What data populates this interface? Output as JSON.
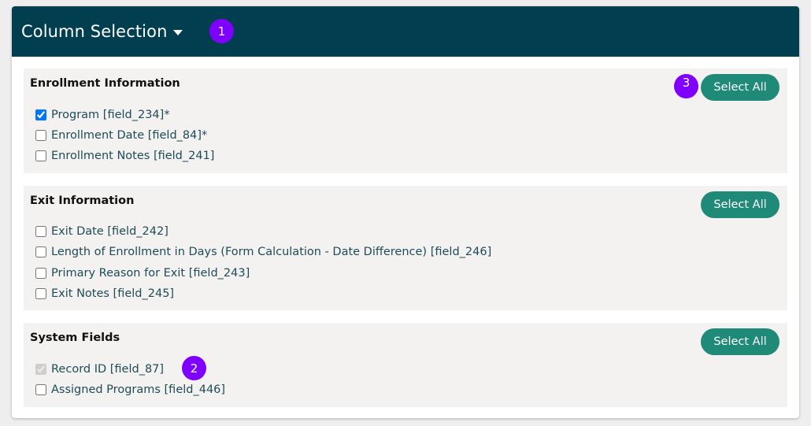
{
  "panel": {
    "title": "Column Selection",
    "markers": {
      "m1": "1",
      "m2": "2",
      "m3": "3"
    }
  },
  "sections": [
    {
      "title": "Enrollment Information",
      "select_all_label": "Select All",
      "fields": [
        {
          "label": "Program [field_234]*",
          "checked": true,
          "disabled": false
        },
        {
          "label": "Enrollment Date [field_84]*",
          "checked": false,
          "disabled": false
        },
        {
          "label": "Enrollment Notes [field_241]",
          "checked": false,
          "disabled": false
        }
      ]
    },
    {
      "title": "Exit Information",
      "select_all_label": "Select All",
      "fields": [
        {
          "label": "Exit Date [field_242]",
          "checked": false,
          "disabled": false
        },
        {
          "label": "Length of Enrollment in Days (Form Calculation - Date Difference) [field_246]",
          "checked": false,
          "disabled": false
        },
        {
          "label": "Primary Reason for Exit [field_243]",
          "checked": false,
          "disabled": false
        },
        {
          "label": "Exit Notes [field_245]",
          "checked": false,
          "disabled": false
        }
      ]
    },
    {
      "title": "System Fields",
      "select_all_label": "Select All",
      "fields": [
        {
          "label": "Record ID [field_87]",
          "checked": true,
          "disabled": true
        },
        {
          "label": "Assigned Programs [field_446]",
          "checked": false,
          "disabled": false
        }
      ]
    }
  ],
  "colors": {
    "header_bg": "#003e50",
    "button_bg": "#1f8a78",
    "marker_bg": "#8000ff",
    "section_bg": "#f3f2f1",
    "field_text": "#1e4b57"
  }
}
